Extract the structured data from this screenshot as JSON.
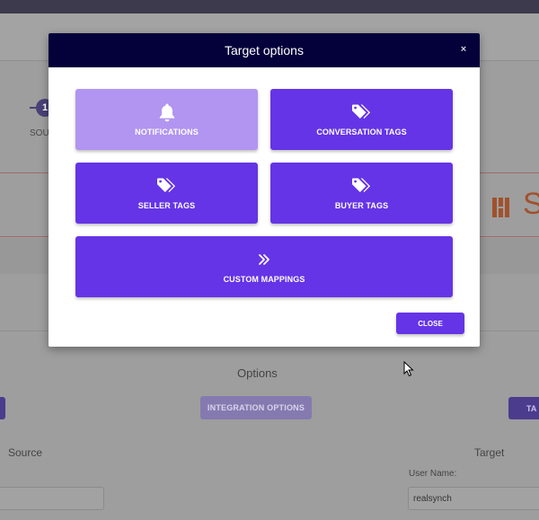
{
  "background": {
    "step": {
      "number": "1",
      "label": "SOU"
    },
    "options_label": "Options",
    "integration_button": "INTEGRATION OPTIONS",
    "right_button_label": "TA",
    "source_label": "Source",
    "target_label": "Target",
    "username_label": "User Name:",
    "username_value": "realsynch",
    "logo_text": "S"
  },
  "modal": {
    "title": "Target options",
    "close_glyph": "×",
    "tiles": [
      {
        "label": "NOTIFICATIONS",
        "icon": "bell-icon"
      },
      {
        "label": "CONVERSATION TAGS",
        "icon": "tags-icon"
      },
      {
        "label": "SELLER TAGS",
        "icon": "tags-icon"
      },
      {
        "label": "BUYER TAGS",
        "icon": "tags-icon"
      },
      {
        "label": "CUSTOM MAPPINGS",
        "icon": "double-chevron-right-icon"
      }
    ],
    "close_button": "CLOSE"
  },
  "colors": {
    "header": "#03003a",
    "accent": "#6534e6",
    "accent_light": "#b195f0"
  }
}
